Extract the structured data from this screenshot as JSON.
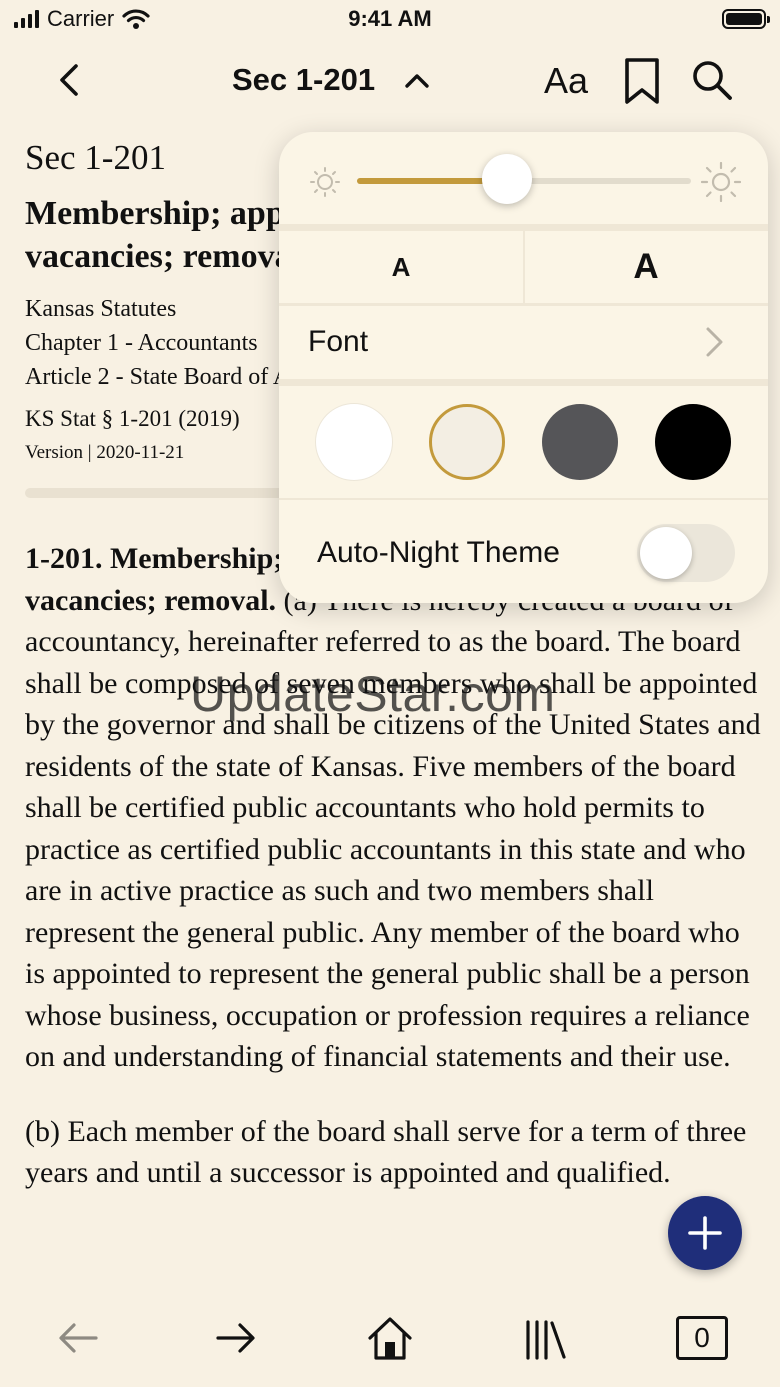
{
  "status_bar": {
    "carrier": "Carrier",
    "time": "9:41 AM"
  },
  "nav": {
    "title": "Sec 1-201",
    "font_settings_label": "Aa"
  },
  "document": {
    "section": "Sec 1-201",
    "heading": "Membership; appointment; qualifications; term; vacancies; removal.",
    "source": "Kansas Statutes",
    "chapter": "Chapter 1 - Accountants",
    "article": "Article 2 - State Board of Accountancy",
    "citation": "KS Stat § 1-201 (2019)",
    "version": "Version | 2020-11-21",
    "body_lead": "1-201. Membership; appointment; qualifications; term; vacancies; removal.",
    "body_text": " (a) There is hereby created a board of accountancy, hereinafter referred to as the board. The board shall be composed of seven members who shall be appointed by the governor and shall be citizens of the United States and residents of the state of Kansas. Five members of the board shall be certified public accountants who hold permits to practice as certified public accountants in this state and who are in active practice as such and two members shall represent the general public. Any member of the board who is appointed to represent the general public shall be a person whose business, occupation or profession requires a reliance on and understanding of financial statements and their use.",
    "body_para2": "(b) Each member of the board shall serve for a term of three years and until a successor is appointed and qualified."
  },
  "watermark": "UpdateStar.com",
  "appearance_popover": {
    "brightness": 0.45,
    "font_decrease_label": "A",
    "font_increase_label": "A",
    "font_label": "Font",
    "themes": [
      {
        "name": "white",
        "color": "#ffffff",
        "selected": false
      },
      {
        "name": "sepia",
        "color": "#f3eee3",
        "selected": true
      },
      {
        "name": "gray",
        "color": "#555558",
        "selected": false
      },
      {
        "name": "black",
        "color": "#000000",
        "selected": false
      }
    ],
    "auto_night_label": "Auto-Night Theme",
    "auto_night_on": false,
    "accent_color": "#c39a3c"
  },
  "toolbar": {
    "tab_count": "0"
  },
  "colors": {
    "background": "#f8f1e3",
    "fab": "#1f2e7a"
  }
}
